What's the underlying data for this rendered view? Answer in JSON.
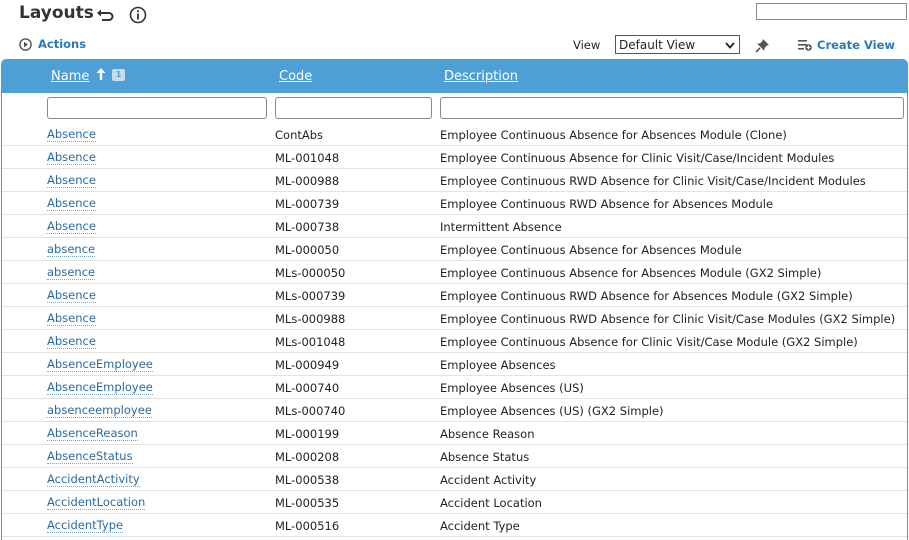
{
  "header": {
    "title": "Layouts",
    "search_value": ""
  },
  "toolbar": {
    "actions_label": "Actions",
    "view_label": "View",
    "view_selected": "Default View",
    "create_view_label": "Create View"
  },
  "grid": {
    "columns": [
      {
        "label": "Name"
      },
      {
        "label": "Code"
      },
      {
        "label": "Description"
      }
    ],
    "sort_badge": "1",
    "rows": [
      {
        "name": "Absence",
        "code": "ContAbs",
        "description": "Employee Continuous Absence for Absences Module (Clone)"
      },
      {
        "name": "Absence",
        "code": "ML-001048",
        "description": "Employee Continuous Absence for Clinic Visit/Case/Incident Modules"
      },
      {
        "name": "Absence",
        "code": "ML-000988",
        "description": "Employee Continuous RWD Absence for Clinic Visit/Case/Incident Modules"
      },
      {
        "name": "Absence",
        "code": "ML-000739",
        "description": "Employee Continuous RWD Absence for Absences Module"
      },
      {
        "name": "Absence",
        "code": "ML-000738",
        "description": "Intermittent Absence"
      },
      {
        "name": "absence",
        "code": "ML-000050",
        "description": "Employee Continuous Absence for Absences Module"
      },
      {
        "name": "absence",
        "code": "MLs-000050",
        "description": "Employee Continuous Absence for Absences Module (GX2 Simple)"
      },
      {
        "name": "Absence",
        "code": "MLs-000739",
        "description": "Employee Continuous RWD Absence for Absences Module (GX2 Simple)"
      },
      {
        "name": "Absence",
        "code": "MLs-000988",
        "description": "Employee Continuous RWD Absence for Clinic Visit/Case Modules (GX2 Simple)"
      },
      {
        "name": "Absence",
        "code": "MLs-001048",
        "description": "Employee Continuous Absence for Clinic Visit/Case Module (GX2 Simple)"
      },
      {
        "name": "AbsenceEmployee",
        "code": "ML-000949",
        "description": "Employee Absences"
      },
      {
        "name": "AbsenceEmployee",
        "code": "ML-000740",
        "description": "Employee Absences (US)"
      },
      {
        "name": "absenceemployee",
        "code": "MLs-000740",
        "description": "Employee Absences (US) (GX2 Simple)"
      },
      {
        "name": "AbsenceReason",
        "code": "ML-000199",
        "description": "Absence Reason"
      },
      {
        "name": "AbsenceStatus",
        "code": "ML-000208",
        "description": "Absence Status"
      },
      {
        "name": "AccidentActivity",
        "code": "ML-000538",
        "description": "Accident Activity"
      },
      {
        "name": "AccidentLocation",
        "code": "ML-000535",
        "description": "Accident Location"
      },
      {
        "name": "AccidentType",
        "code": "ML-000516",
        "description": "Accident Type"
      }
    ]
  },
  "icons": {
    "back": "return-arrow-icon",
    "info": "info-icon",
    "actions": "play-circle-icon",
    "pin": "pin-icon",
    "create_view": "list-add-icon",
    "sort": "sort-ascending-arrow-icon",
    "dropdown": "chevron-down-icon"
  },
  "colors": {
    "header_blue": "#4d9fd6",
    "link_blue": "#2a7ab8"
  }
}
